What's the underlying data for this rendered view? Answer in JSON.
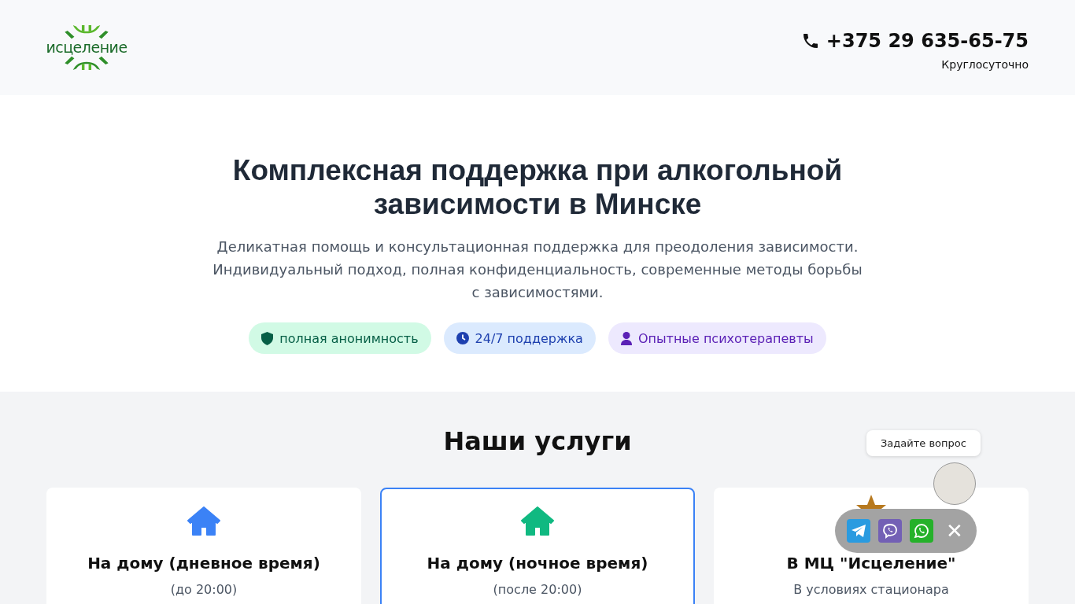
{
  "header": {
    "logo_text": "исцеление",
    "phone": "+375 29 635-65-75",
    "hours": "Круглосуточно"
  },
  "hero": {
    "title": "Комплексная поддержка при алкогольной зависимости в Минске",
    "subtitle": "Деликатная помощь и консультационная поддержка для преодоления зависимости. Индивидуальный подход, полная конфиденциальность, современные методы борьбы с зависимостями.",
    "badges": [
      {
        "kind": "shield",
        "label": "полная анонимность",
        "color": "#d1fae5"
      },
      {
        "kind": "clock",
        "label": "24/7 поддержка",
        "color": "#dbeafe"
      },
      {
        "kind": "doctor",
        "label": "Опытные психотерапевты",
        "color": "#ede9fe"
      }
    ]
  },
  "services": {
    "title": "Наши услуги",
    "cards": [
      {
        "kind": "house",
        "color": "#3b82f6",
        "title": "На дому (дневное время)",
        "note": "(до 20:00)",
        "highlighted": false
      },
      {
        "kind": "house",
        "color": "#10b981",
        "title": "На дому (ночное время)",
        "note": "(после 20:00)",
        "highlighted": true
      },
      {
        "kind": "star",
        "color": "#b7791f",
        "title": "В МЦ \"Исцеление\"",
        "note": "В условиях стационара",
        "highlighted": false
      }
    ]
  },
  "chat_widget": {
    "prompt": "Задайте вопрос",
    "messengers": [
      {
        "kind": "telegram"
      },
      {
        "kind": "viber"
      },
      {
        "kind": "whatsapp"
      }
    ],
    "close": "✕"
  }
}
